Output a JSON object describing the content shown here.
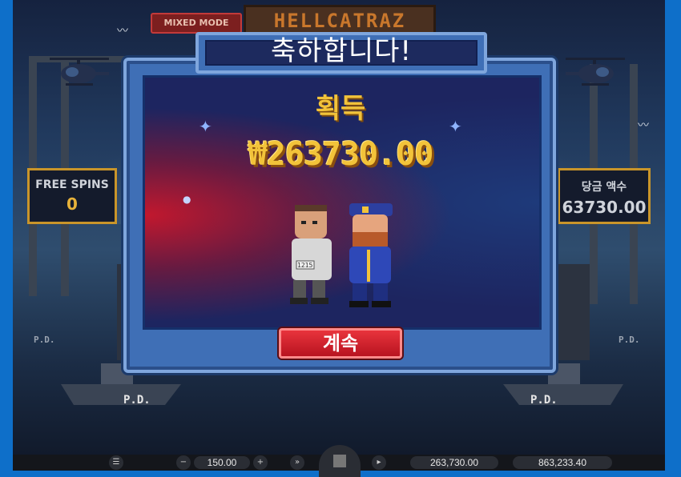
{
  "game": {
    "logo_text": "HELLCATRAZ",
    "mode_badge": "MIXED MODE",
    "free_spins": {
      "label": "FREE SPINS",
      "value": "0"
    },
    "total_win_panel": {
      "label": "당금 액수",
      "value": "63730.00"
    },
    "boat_labels": [
      "P.D.",
      "P.D.",
      "P.D.",
      "P.D."
    ]
  },
  "modal": {
    "title": "축하합니다!",
    "win_label": "획득",
    "win_amount": "₩263730.00",
    "continue_label": "계속",
    "prisoner_number": "1215"
  },
  "bottom_bar": {
    "menu_icon": "hamburger-icon",
    "bet": "150.00",
    "win": "263,730.00",
    "balance": "863,233.40"
  },
  "colors": {
    "gold": "#f2c33a",
    "frame_blue": "#3f6fb6",
    "continue_red": "#d81f2b",
    "desktop_blue": "#0e6fc9"
  }
}
